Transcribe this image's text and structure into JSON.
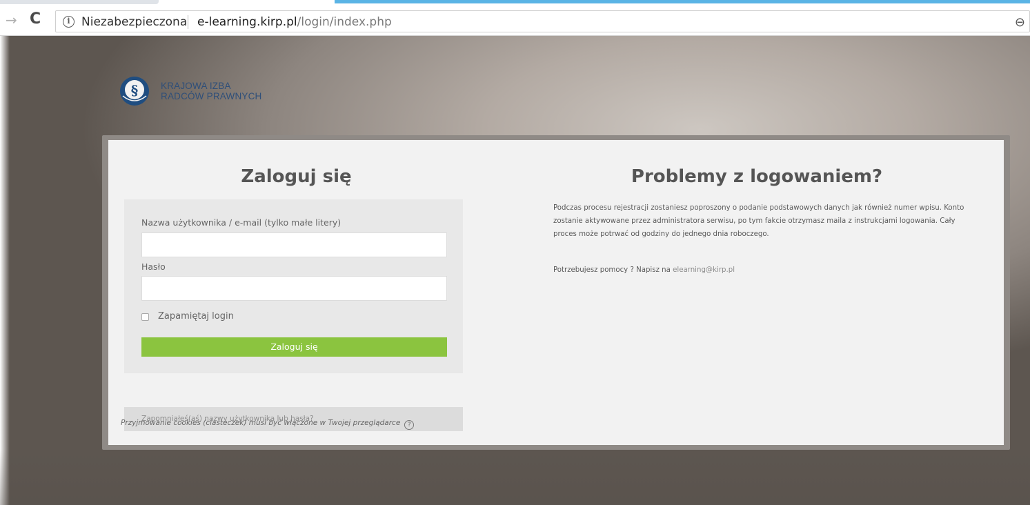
{
  "browser": {
    "security_label": "Niezabezpieczona",
    "url_host": "e-learning.kirp.pl",
    "url_path": "/login/index.php",
    "accent_color": "#5ab4e5"
  },
  "icons": {
    "forward": "arrow-right-icon",
    "reload": "reload-icon",
    "info": "info-icon",
    "zoom": "zoom-icon",
    "help": "help-icon",
    "seal": "kirp-seal-icon"
  },
  "brand": {
    "line1": "KRAJOWA IZBA",
    "line2": "RADCÓW PRAWNYCH",
    "color": "#2f4f79"
  },
  "login": {
    "title": "Zaloguj się",
    "username_label": "Nazwa użytkownika / e-mail (tylko małe litery)",
    "username_value": "",
    "password_label": "Hasło",
    "password_value": "",
    "remember_label": "Zapamiętaj login",
    "remember_checked": false,
    "submit_label": "Zaloguj się",
    "submit_color": "#8bc43f",
    "forgot_link": "Zapomniałeś(aś) nazwy użytkownika lub hasła?",
    "cookies_note": "Przyjmowanie cookies (ciasteczek) musi być włączone w Twojej przeglądarce"
  },
  "problems": {
    "title": "Problemy z logowaniem?",
    "text": "Podczas procesu rejestracji zostaniesz poproszony o podanie podstawowych danych jak również numer wpisu. Konto zostanie aktywowane przez administratora serwisu, po tym fakcie otrzymasz maila z instrukcjami logowania. Cały proces może potrwać od godziny do jednego dnia roboczego.",
    "help_prefix": "Potrzebujesz pomocy ? Napisz na ",
    "help_email": "elearning@kirp.pl"
  }
}
